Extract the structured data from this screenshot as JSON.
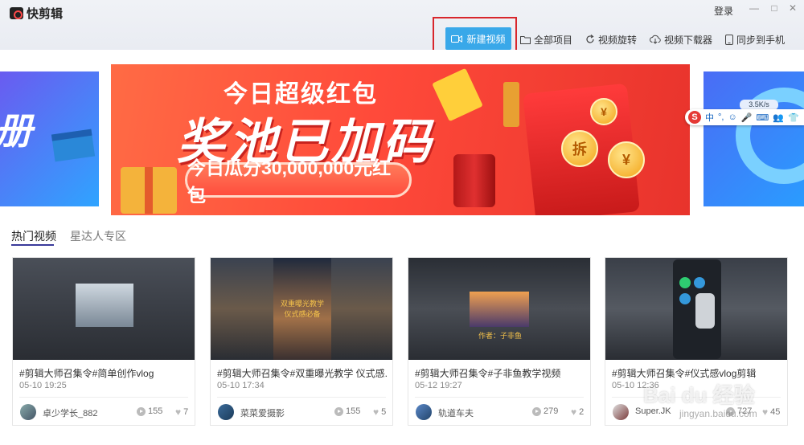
{
  "app": {
    "title": "快剪辑"
  },
  "window": {
    "login_label": "登录",
    "minimize": "—",
    "maximize": "□",
    "close": "✕"
  },
  "toolbar": {
    "new_video": "新建视频",
    "all_projects": "全部项目",
    "rotate_video": "视频旋转",
    "video_downloader": "视频下载器",
    "sync_to_phone": "同步到手机"
  },
  "banner": {
    "line1": "今日超级红包",
    "line2": "奖池已加码",
    "pill": "今日瓜分30,000,000元红包",
    "coin_text": "拆",
    "coin_yen": "¥"
  },
  "left_side_banner": {
    "text": "册"
  },
  "ime": {
    "logo": "S",
    "items": [
      "中",
      "°,",
      "☺",
      "🎤",
      "⌨",
      "👥",
      "👕"
    ],
    "speed": "3.5K/s"
  },
  "tabs": [
    {
      "label": "热门视频",
      "active": true
    },
    {
      "label": "星达人专区",
      "active": false
    }
  ],
  "videos": [
    {
      "title": "#剪辑大师召集令#简单创作vlog",
      "date": "05-10 19:25",
      "author": "卓少学长_882",
      "plays": "155",
      "likes": "7"
    },
    {
      "title": "#剪辑大师召集令#双重曝光教学 仪式感...",
      "date": "05-10 17:34",
      "author": "菜菜爱摄影",
      "plays": "155",
      "likes": "5"
    },
    {
      "title": "#剪辑大师召集令#子非鱼教学视频",
      "date": "05-12 19:27",
      "author": "轨道车夫",
      "plays": "279",
      "likes": "2"
    },
    {
      "title": "#剪辑大师召集令#仪式感vlog剪辑",
      "date": "05-10 12:36",
      "author": "Super.JK",
      "plays": "727",
      "likes": "45"
    }
  ],
  "thumb_captions": {
    "v2": "双重曝光教学\n仪式感必备",
    "v3": "作者：子非鱼"
  },
  "watermark": {
    "text": "Bai du 经验",
    "url": "jingyan.baidu.com"
  },
  "colors": {
    "accent": "#39a8e9",
    "highlight": "#d8262c",
    "banner": "#ff4a3a"
  }
}
